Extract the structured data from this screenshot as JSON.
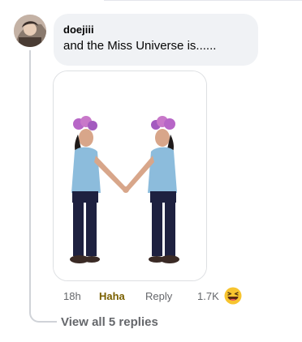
{
  "comment": {
    "author": "doejiii",
    "text": "and the Miss Universe is......",
    "timestamp": "18h",
    "reaction_label": "Haha",
    "reply_label": "Reply",
    "reaction_count": "1.7K",
    "reaction_icon": "haha-emoji-icon"
  },
  "replies": {
    "view_label": "View all 5 replies"
  },
  "colors": {
    "bubble_bg": "#f0f2f5",
    "haha_accent": "#7a6000",
    "muted_text": "#65676b",
    "emoji_yellow": "#f7c42f"
  }
}
